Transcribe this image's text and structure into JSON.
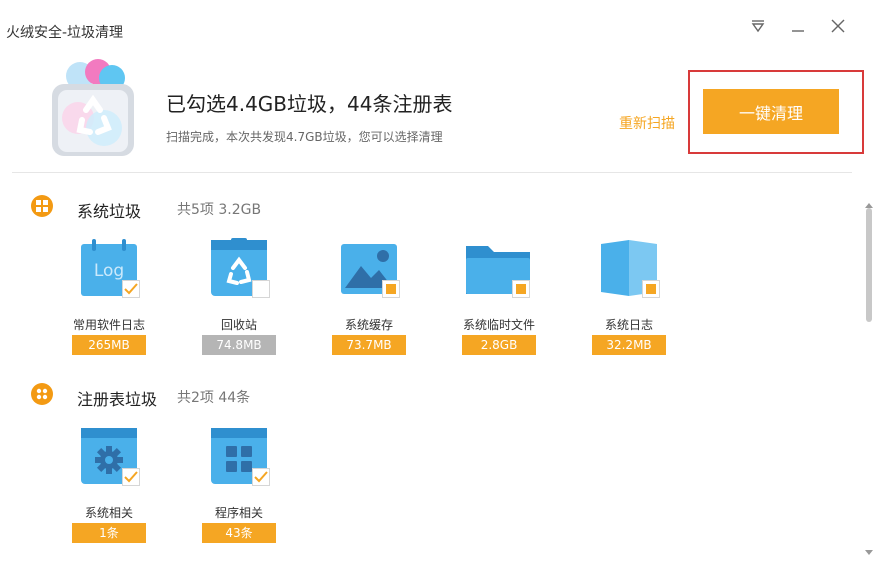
{
  "window": {
    "title": "火绒安全-垃圾清理",
    "controls": [
      "menu-icon",
      "minimize-icon",
      "close-icon"
    ]
  },
  "header": {
    "headline": "已勾选4.4GB垃圾，44条注册表",
    "subline": "扫描完成，本次共发现4.7GB垃圾，您可以选择清理",
    "rescan_label": "重新扫描",
    "clean_label": "一键清理",
    "accent": "#f5a623",
    "highlight_color": "#d83a3a"
  },
  "sections": [
    {
      "title": "系统垃圾",
      "meta": "共5项 3.2GB",
      "items": [
        {
          "label": "常用软件日志",
          "size": "265MB",
          "state": "checked",
          "icon": "log-icon"
        },
        {
          "label": "回收站",
          "size": "74.8MB",
          "state": "unchecked",
          "icon": "recycle-bin-icon"
        },
        {
          "label": "系统缓存",
          "size": "73.7MB",
          "state": "partial",
          "icon": "image-cache-icon"
        },
        {
          "label": "系统临时文件",
          "size": "2.8GB",
          "state": "partial",
          "icon": "folder-icon"
        },
        {
          "label": "系统日志",
          "size": "32.2MB",
          "state": "partial",
          "icon": "book-icon"
        }
      ]
    },
    {
      "title": "注册表垃圾",
      "meta": "共2项 44条",
      "items": [
        {
          "label": "系统相关",
          "size": "1条",
          "state": "checked",
          "icon": "gear-icon"
        },
        {
          "label": "程序相关",
          "size": "43条",
          "state": "checked",
          "icon": "apps-grid-icon"
        }
      ]
    }
  ]
}
